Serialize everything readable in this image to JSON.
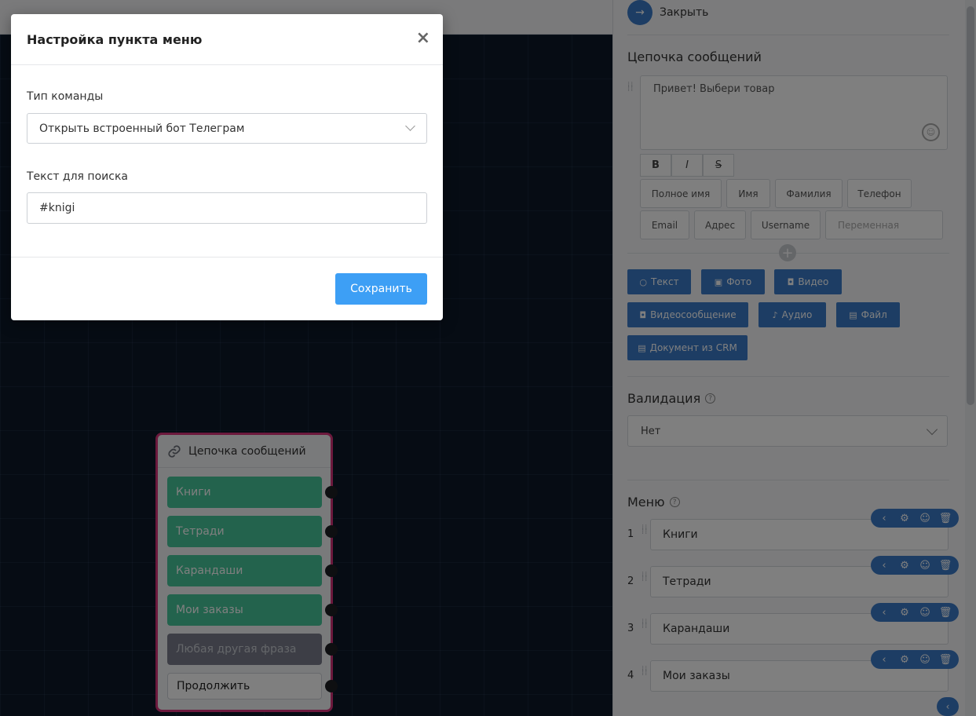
{
  "modal": {
    "title": "Настройка пункта меню",
    "close_symbol": "×",
    "command_type_label": "Тип команды",
    "command_type_value": "Открыть встроенный бот Телеграм",
    "search_label": "Текст для поиска",
    "search_value": "#knigi",
    "save_label": "Сохранить"
  },
  "node": {
    "title": "Цепочка сообщений",
    "items": [
      "Книги",
      "Тетради",
      "Карандаши",
      "Мои заказы",
      "Любая другая фраза",
      "Продолжить"
    ]
  },
  "panel": {
    "close_label": "Закрыть",
    "chain_title": "Цепочка сообщений",
    "message_text": "Привет! Выбери  товар",
    "format_buttons": [
      "B",
      "I",
      "S"
    ],
    "variables": [
      "Полное имя",
      "Имя",
      "Фамилия",
      "Телефон",
      "Email",
      "Адрес",
      "Username"
    ],
    "variable_placeholder": "Переменная",
    "content_buttons": [
      {
        "label": "Текст",
        "icon": "speech-bubble-icon"
      },
      {
        "label": "Фото",
        "icon": "image-icon"
      },
      {
        "label": "Видео",
        "icon": "video-camera-icon"
      },
      {
        "label": "Видеосообщение",
        "icon": "video-camera-icon"
      },
      {
        "label": "Аудио",
        "icon": "microphone-icon"
      },
      {
        "label": "Файл",
        "icon": "file-icon"
      },
      {
        "label": "Документ из CRM",
        "icon": "file-icon"
      }
    ],
    "validation_title": "Валидация",
    "validation_value": "Нет",
    "menu_title": "Меню",
    "menu_items": [
      {
        "num": "1",
        "label": "Книги"
      },
      {
        "num": "2",
        "label": "Тетради"
      },
      {
        "num": "3",
        "label": "Карандаши"
      },
      {
        "num": "4",
        "label": "Мои заказы"
      }
    ]
  },
  "colors": {
    "accent": "#3b7bc9",
    "save_button": "#3d9ff5",
    "node_border": "#d8337a",
    "menu_item_green": "#47c79b"
  }
}
